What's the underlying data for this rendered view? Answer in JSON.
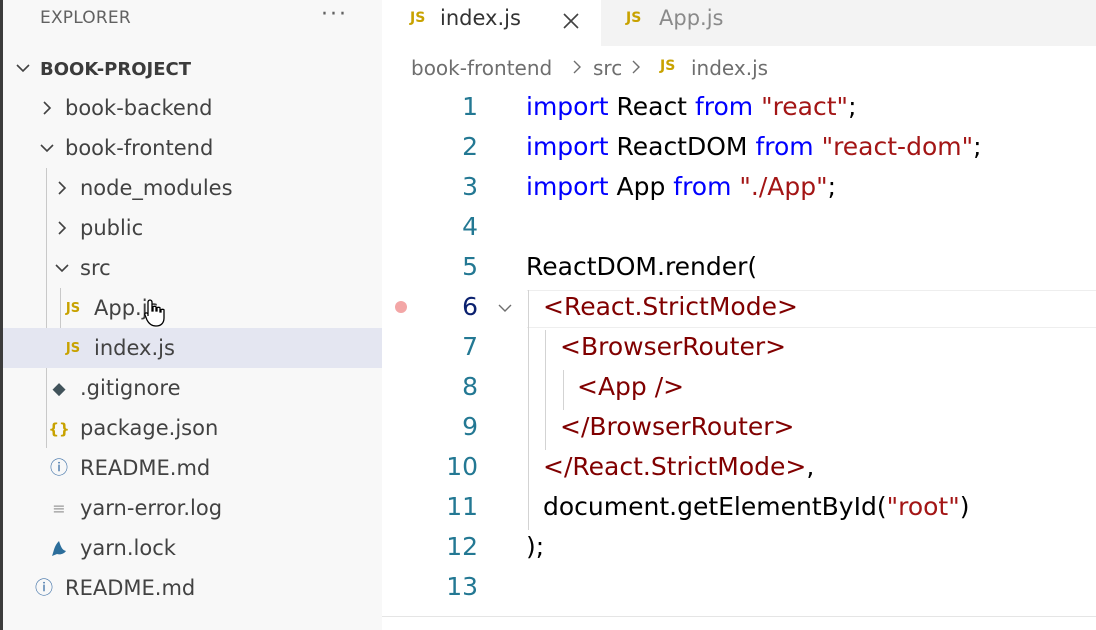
{
  "explorer": {
    "title": "EXPLORER",
    "more_label": "···",
    "project_name": "BOOK-PROJECT"
  },
  "tree": {
    "book_backend": "book-backend",
    "book_frontend": "book-frontend",
    "node_modules": "node_modules",
    "public": "public",
    "src": "src",
    "app_js": "App.js",
    "index_js": "index.js",
    "gitignore": ".gitignore",
    "package_json": "package.json",
    "readme_frontend": "README.md",
    "yarn_error_log": "yarn-error.log",
    "yarn_lock": "yarn.lock",
    "readme_root": "README.md",
    "js_icon": "JS",
    "json_icon": "{}",
    "info_icon": "ⓘ",
    "git_icon": "◆",
    "log_icon": "≡"
  },
  "tabs": [
    {
      "label": "index.js",
      "badge": "JS",
      "active": true
    },
    {
      "label": "App.js",
      "badge": "JS",
      "active": false
    }
  ],
  "breadcrumb": {
    "part1": "book-frontend",
    "part2": "src",
    "part3": "index.js",
    "badge": "JS"
  },
  "editor": {
    "active_line": 6,
    "line_numbers": [
      "1",
      "2",
      "3",
      "4",
      "5",
      "6",
      "7",
      "8",
      "9",
      "10",
      "11",
      "12",
      "13"
    ],
    "lines": [
      [
        {
          "t": "kw",
          "v": "import"
        },
        {
          "t": "pl",
          "v": " React "
        },
        {
          "t": "kw",
          "v": "from"
        },
        {
          "t": "pl",
          "v": " "
        },
        {
          "t": "str",
          "v": "\"react\""
        },
        {
          "t": "pl",
          "v": ";"
        }
      ],
      [
        {
          "t": "kw",
          "v": "import"
        },
        {
          "t": "pl",
          "v": " ReactDOM "
        },
        {
          "t": "kw",
          "v": "from"
        },
        {
          "t": "pl",
          "v": " "
        },
        {
          "t": "str",
          "v": "\"react-dom\""
        },
        {
          "t": "pl",
          "v": ";"
        }
      ],
      [
        {
          "t": "kw",
          "v": "import"
        },
        {
          "t": "pl",
          "v": " App "
        },
        {
          "t": "kw",
          "v": "from"
        },
        {
          "t": "pl",
          "v": " "
        },
        {
          "t": "str",
          "v": "\"./App\""
        },
        {
          "t": "pl",
          "v": ";"
        }
      ],
      [],
      [
        {
          "t": "pl",
          "v": "ReactDOM.render("
        }
      ],
      [
        {
          "t": "tag",
          "v": "<React.StrictMode>"
        }
      ],
      [
        {
          "t": "tag",
          "v": "<BrowserRouter>"
        }
      ],
      [
        {
          "t": "tag",
          "v": "<App />"
        }
      ],
      [
        {
          "t": "tag",
          "v": "</BrowserRouter>"
        }
      ],
      [
        {
          "t": "tag",
          "v": "</React.StrictMode>"
        },
        {
          "t": "pl",
          "v": ","
        }
      ],
      [
        {
          "t": "pl",
          "v": "document.getElementById("
        },
        {
          "t": "str",
          "v": "\"root\""
        },
        {
          "t": "pl",
          "v": ")"
        }
      ],
      [
        {
          "t": "pl",
          "v": ");"
        }
      ],
      []
    ]
  },
  "colors": {
    "keyword": "#0000ff",
    "string": "#a31515",
    "jsx_tag": "#800000",
    "line_number": "#237893",
    "js_badge": "#c8a200",
    "selection": "#e4e6f1"
  }
}
